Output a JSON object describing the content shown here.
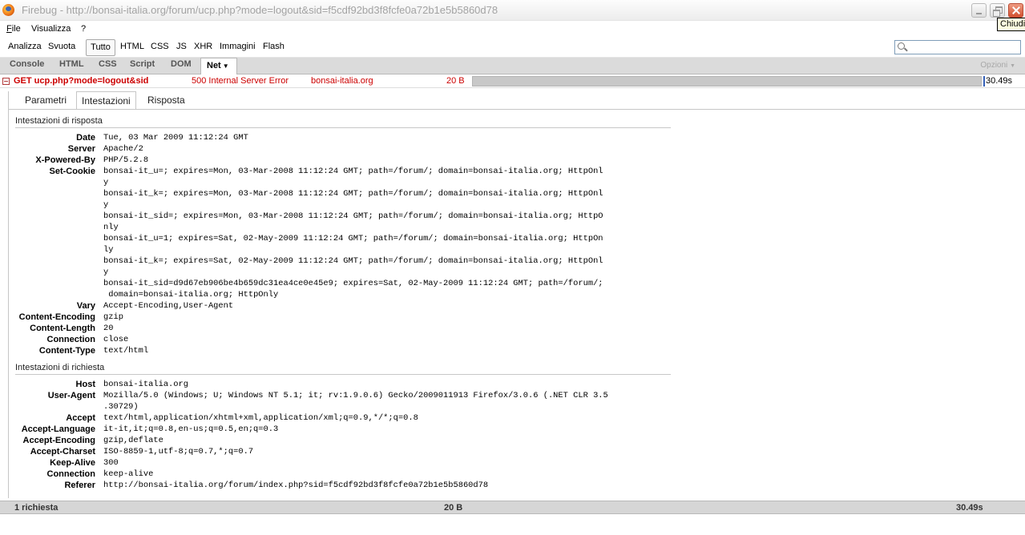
{
  "window": {
    "title": "Firebug - http://bonsai-italia.org/forum/ucp.php?mode=logout&sid=f5cdf92bd3f8fcfe0a72b1e5b5860d78",
    "close_tooltip": "Chiudi"
  },
  "menubar": {
    "file_first": "F",
    "file_rest": "ile",
    "visualizza": "Visualizza",
    "help": "?"
  },
  "net_toolbar": {
    "analizza": "Analizza",
    "svuota": "Svuota",
    "filters": [
      "Tutto",
      "HTML",
      "CSS",
      "JS",
      "XHR",
      "Immagini",
      "Flash"
    ],
    "active_filter": "Tutto",
    "search_value": ""
  },
  "panel_tabs": {
    "console": "Console",
    "html": "HTML",
    "css": "CSS",
    "script": "Script",
    "dom": "DOM",
    "net": "Net",
    "options": "Opzioni"
  },
  "request": {
    "url": "GET ucp.php?mode=logout&sid",
    "status": "500 Internal Server Error",
    "domain": "bonsai-italia.org",
    "size": "20 B",
    "time": "30.49s"
  },
  "detail_tabs": {
    "parametri": "Parametri",
    "intestazioni": "Intestazioni",
    "risposta": "Risposta"
  },
  "response_section": {
    "title": "Intestazioni di risposta",
    "headers": [
      {
        "name": "Date",
        "lines": [
          "Tue, 03 Mar 2009 11:12:24 GMT"
        ]
      },
      {
        "name": "Server",
        "lines": [
          "Apache/2"
        ]
      },
      {
        "name": "X-Powered-By",
        "lines": [
          "PHP/5.2.8"
        ]
      },
      {
        "name": "Set-Cookie",
        "lines": [
          "bonsai-it_u=; expires=Mon, 03-Mar-2008 11:12:24 GMT; path=/forum/; domain=bonsai-italia.org; HttpOnl",
          "y",
          "bonsai-it_k=; expires=Mon, 03-Mar-2008 11:12:24 GMT; path=/forum/; domain=bonsai-italia.org; HttpOnl",
          "y",
          "bonsai-it_sid=; expires=Mon, 03-Mar-2008 11:12:24 GMT; path=/forum/; domain=bonsai-italia.org; HttpO",
          "nly",
          "bonsai-it_u=1; expires=Sat, 02-May-2009 11:12:24 GMT; path=/forum/; domain=bonsai-italia.org; HttpOn",
          "ly",
          "bonsai-it_k=; expires=Sat, 02-May-2009 11:12:24 GMT; path=/forum/; domain=bonsai-italia.org; HttpOnl",
          "y",
          "bonsai-it_sid=d9d67eb906be4b659dc31ea4ce0e45e9; expires=Sat, 02-May-2009 11:12:24 GMT; path=/forum/;",
          " domain=bonsai-italia.org; HttpOnly"
        ]
      },
      {
        "name": "Vary",
        "lines": [
          "Accept-Encoding,User-Agent"
        ]
      },
      {
        "name": "Content-Encoding",
        "lines": [
          "gzip"
        ]
      },
      {
        "name": "Content-Length",
        "lines": [
          "20"
        ]
      },
      {
        "name": "Connection",
        "lines": [
          "close"
        ]
      },
      {
        "name": "Content-Type",
        "lines": [
          "text/html"
        ]
      }
    ]
  },
  "request_section": {
    "title": "Intestazioni di richiesta",
    "headers": [
      {
        "name": "Host",
        "lines": [
          "bonsai-italia.org"
        ]
      },
      {
        "name": "User-Agent",
        "lines": [
          "Mozilla/5.0 (Windows; U; Windows NT 5.1; it; rv:1.9.0.6) Gecko/2009011913 Firefox/3.0.6 (.NET CLR 3.5",
          ".30729)"
        ]
      },
      {
        "name": "Accept",
        "lines": [
          "text/html,application/xhtml+xml,application/xml;q=0.9,*/*;q=0.8"
        ]
      },
      {
        "name": "Accept-Language",
        "lines": [
          "it-it,it;q=0.8,en-us;q=0.5,en;q=0.3"
        ]
      },
      {
        "name": "Accept-Encoding",
        "lines": [
          "gzip,deflate"
        ]
      },
      {
        "name": "Accept-Charset",
        "lines": [
          "ISO-8859-1,utf-8;q=0.7,*;q=0.7"
        ]
      },
      {
        "name": "Keep-Alive",
        "lines": [
          "300"
        ]
      },
      {
        "name": "Connection",
        "lines": [
          "keep-alive"
        ]
      },
      {
        "name": "Referer",
        "lines": [
          "http://bonsai-italia.org/forum/index.php?sid=f5cdf92bd3f8fcfe0a72b1e5b5860d78"
        ]
      }
    ]
  },
  "statusbar": {
    "count": "1 richiesta",
    "size": "20 B",
    "time": "30.49s"
  },
  "colors": {
    "error_text": "#cc0000",
    "panel_bar": "#dbdbdb",
    "timeline_marker": "#3460b8",
    "tooltip_bg": "#ffffe1"
  }
}
